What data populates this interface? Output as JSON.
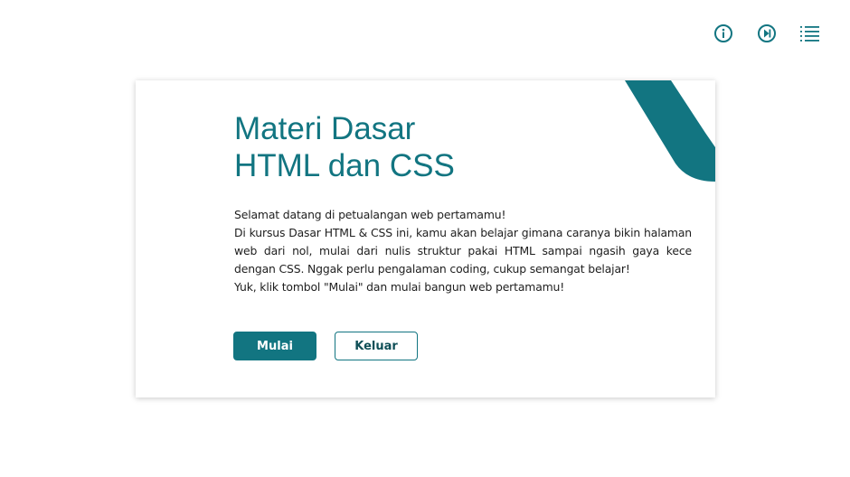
{
  "toolbar": {
    "icons": [
      "info-icon",
      "skip-forward-icon",
      "menu-list-icon"
    ]
  },
  "card": {
    "title_line1": "Materi Dasar",
    "title_line2": "HTML dan CSS",
    "greeting": "Selamat datang di petualangan web pertamamu!",
    "description": "Di kursus Dasar HTML & CSS ini, kamu akan belajar gimana caranya bikin halaman web dari nol, mulai dari nulis struktur pakai HTML sampai ngasih gaya kece dengan CSS. Nggak perlu pengalaman coding, cukup semangat belajar!",
    "call_to_action": "Yuk, klik tombol \"Mulai\" dan mulai bangun web pertamamu!",
    "start_label": "Mulai",
    "exit_label": "Keluar"
  },
  "colors": {
    "accent": "#127581",
    "text": "#1e1e1e"
  }
}
